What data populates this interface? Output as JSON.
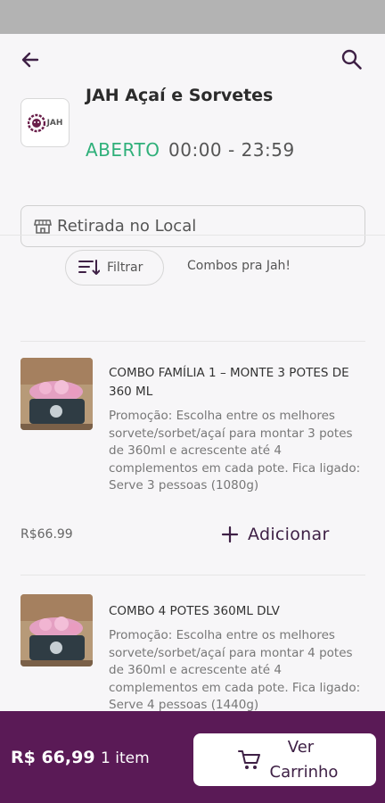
{
  "store": {
    "name": "JAH Açaí e Sorvetes",
    "logo_text": "JAH",
    "status": "ABERTO",
    "hours": "00:00 - 23:59",
    "delivery_mode": "Retirada no Local"
  },
  "filters": {
    "filter_label": "Filtrar",
    "category": "Combos pra Jah!"
  },
  "products": [
    {
      "title": "COMBO FAMÍLIA 1 – MONTE 3 POTES DE 360 ML",
      "description": "Promoção: Escolha entre os melhores sorvete/sorbet/açaí para montar 3 potes de 360ml e acrescente até 4 complementos em cada pote. Fica ligado: Serve 3 pessoas (1080g)",
      "price": "R$66.99",
      "add_label": "Adicionar"
    },
    {
      "title": "COMBO 4 POTES 360ML DLV",
      "description": "Promoção: Escolha entre os melhores sorvete/sorbet/açaí para montar 4 potes de 360ml e acrescente até 4 complementos em cada pote. Fica ligado: Serve 4 pessoas (1440g)"
    }
  ],
  "cart": {
    "total": "R$ 66,99",
    "items": "1 item",
    "button_label": "Ver Carrinho"
  },
  "colors": {
    "brand_purple": "#5a1a56",
    "open_green": "#2fb07a"
  }
}
